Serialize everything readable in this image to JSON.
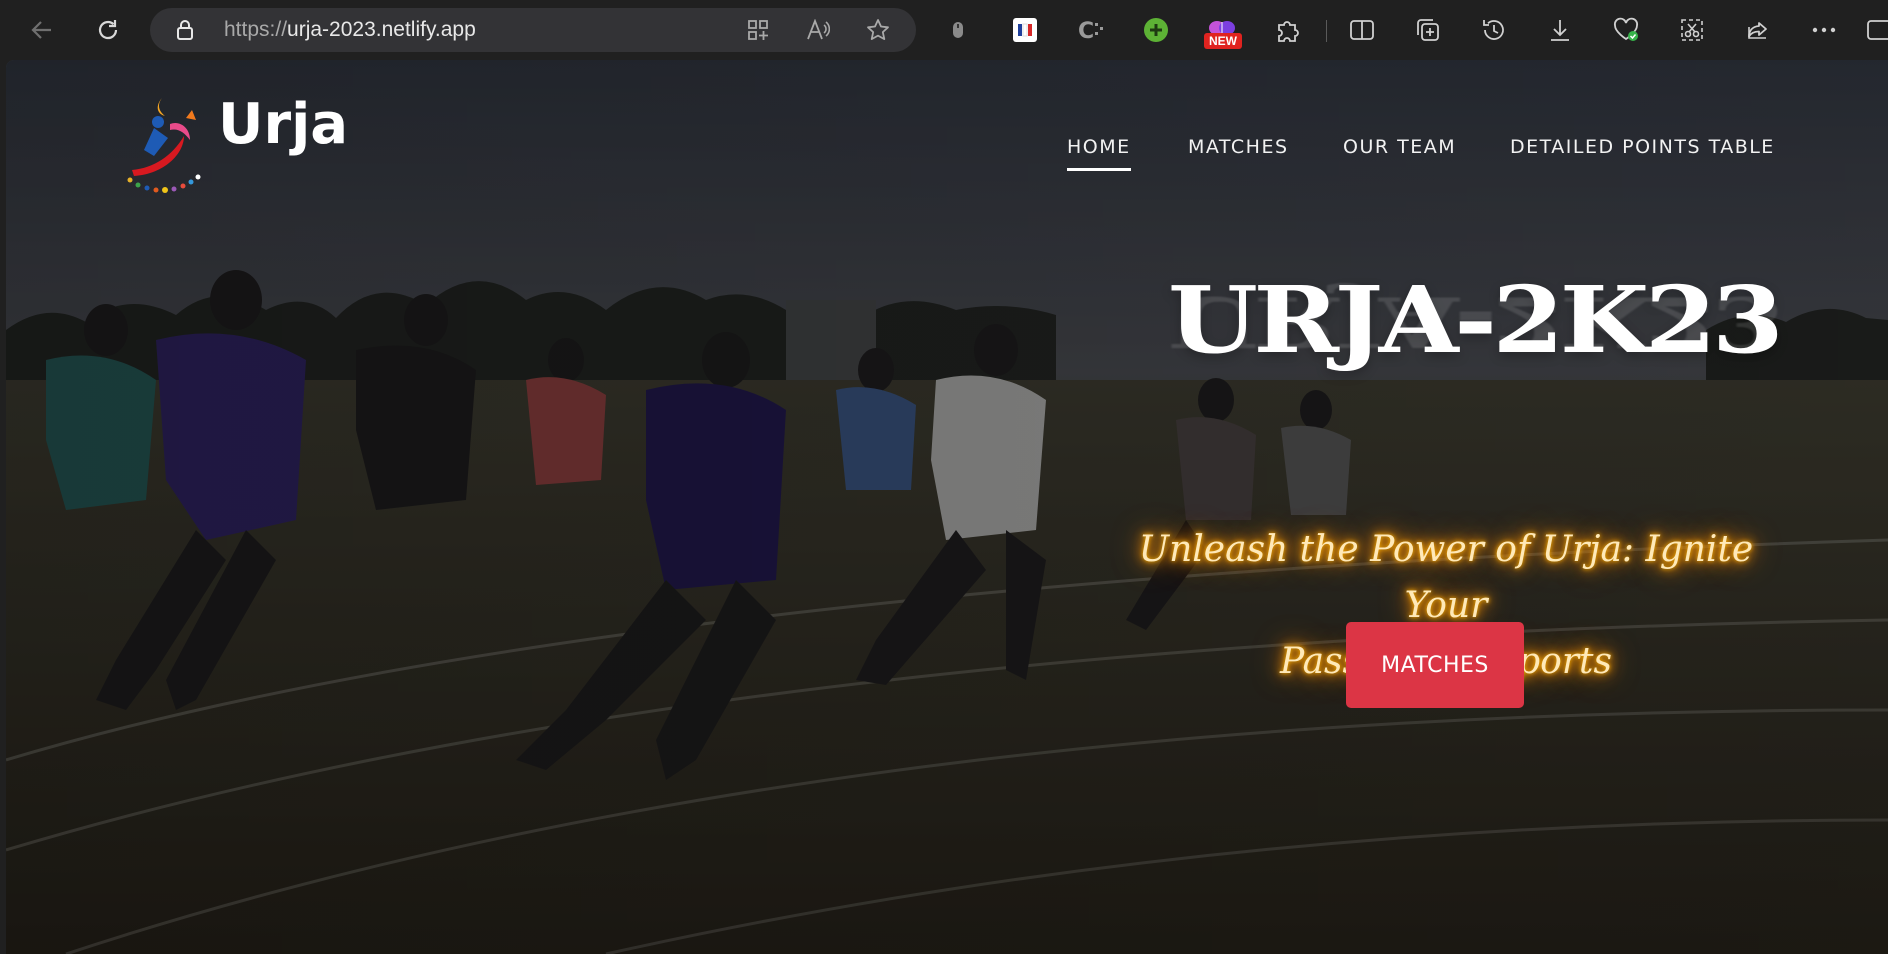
{
  "browser": {
    "url_protocol": "https://",
    "url_host": "urja-2023.netlify.app",
    "new_badge": "NEW"
  },
  "site": {
    "brand": "Urja",
    "nav": [
      {
        "label": "HOME",
        "active": true
      },
      {
        "label": "MATCHES",
        "active": false
      },
      {
        "label": "OUR TEAM",
        "active": false
      },
      {
        "label": "DETAILED POINTS TABLE",
        "active": false
      }
    ],
    "hero": {
      "title": "URJA-2K23",
      "tagline_line1": "Unleash the Power of Urja: Ignite Your",
      "tagline_line2": "Passion for Sports",
      "cta_label": "MATCHES"
    }
  },
  "colors": {
    "accent": "#dc3545",
    "glow": "#ffb300",
    "browser_bg": "#202020"
  }
}
